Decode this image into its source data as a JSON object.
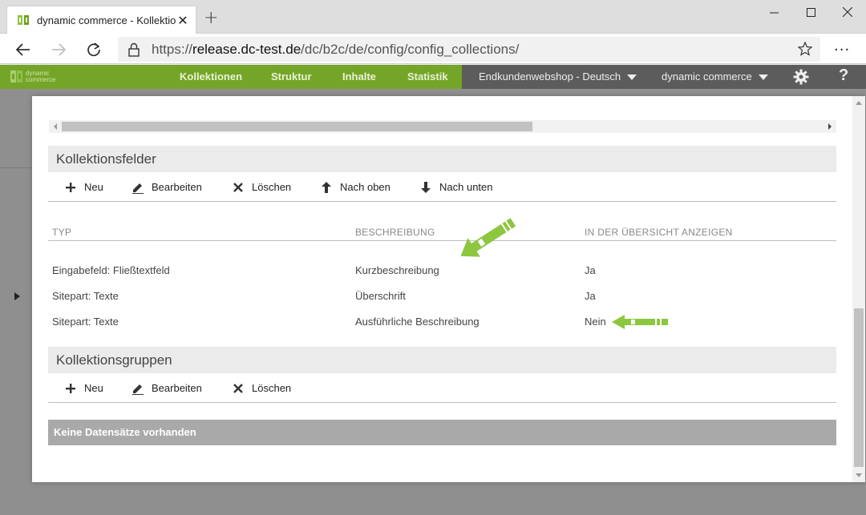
{
  "browser": {
    "tab_title": "dynamic commerce - Kollektione",
    "url_prefix": "https://",
    "url_host": "release.dc-test.de",
    "url_path": "/dc/b2c/de/config/config_collections/"
  },
  "app": {
    "logo_line1": "dynamic",
    "logo_line2": "commerce",
    "nav": [
      "Kollektionen",
      "Struktur",
      "Inhalte",
      "Statistik"
    ],
    "shop_select": "Endkundenwebshop - Deutsch",
    "company_select": "dynamic commerce",
    "help_label": "?"
  },
  "modal": {
    "fields_section": {
      "title": "Kollektionsfelder",
      "toolbar": {
        "new": "Neu",
        "edit": "Bearbeiten",
        "delete": "Löschen",
        "up": "Nach oben",
        "down": "Nach unten"
      },
      "columns": [
        "TYP",
        "BESCHREIBUNG",
        "IN DER ÜBERSICHT ANZEIGEN"
      ],
      "rows": [
        [
          "Eingabefeld: Fließtextfeld",
          "Kurzbeschreibung",
          "Ja"
        ],
        [
          "Sitepart: Texte",
          "Überschrift",
          "Ja"
        ],
        [
          "Sitepart: Texte",
          "Ausführliche Beschreibung",
          "Nein"
        ]
      ]
    },
    "groups_section": {
      "title": "Kollektionsgruppen",
      "toolbar": {
        "new": "Neu",
        "edit": "Bearbeiten",
        "delete": "Löschen"
      },
      "empty_text": "Keine Datensätze vorhanden"
    }
  },
  "colors": {
    "brand_green": "#75a528",
    "annotation_green": "#8dc63f",
    "appbar_gray": "#5c5c5c"
  }
}
